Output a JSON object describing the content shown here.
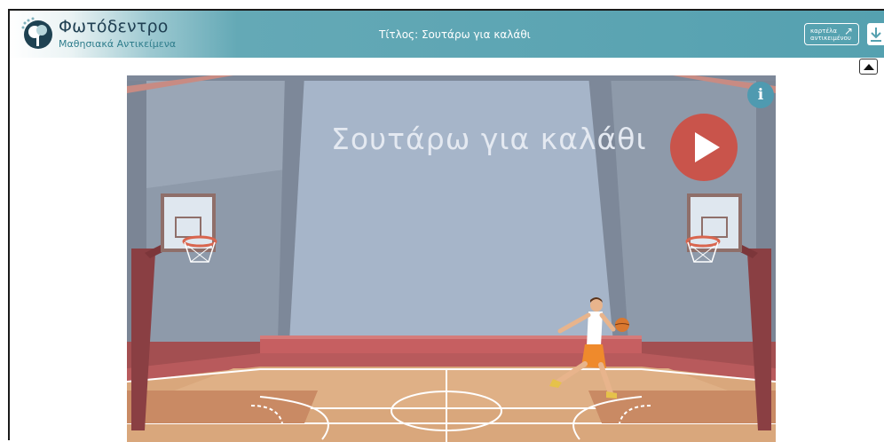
{
  "header": {
    "brand_name": "Φωτόδεντρο",
    "brand_subtitle": "Μαθησιακά Αντικείμενα",
    "page_title": "Τίτλος: Σουτάρω για καλάθι",
    "object_tab_line1": "καρτέλα",
    "object_tab_line2": "αντικειμένου"
  },
  "game": {
    "title": "Σουτάρω για καλάθι"
  },
  "icons": {
    "logo": "photodentro-logo-icon",
    "object_tab": "external-link-icon",
    "download": "download-icon",
    "collapse": "caret-up-icon",
    "info": "info-icon",
    "play": "play-icon"
  },
  "colors": {
    "header_teal": "#55a1b0",
    "play_red": "#c9544b",
    "info_blue": "#4f9ab0",
    "court_wood": "#d9a77c"
  }
}
